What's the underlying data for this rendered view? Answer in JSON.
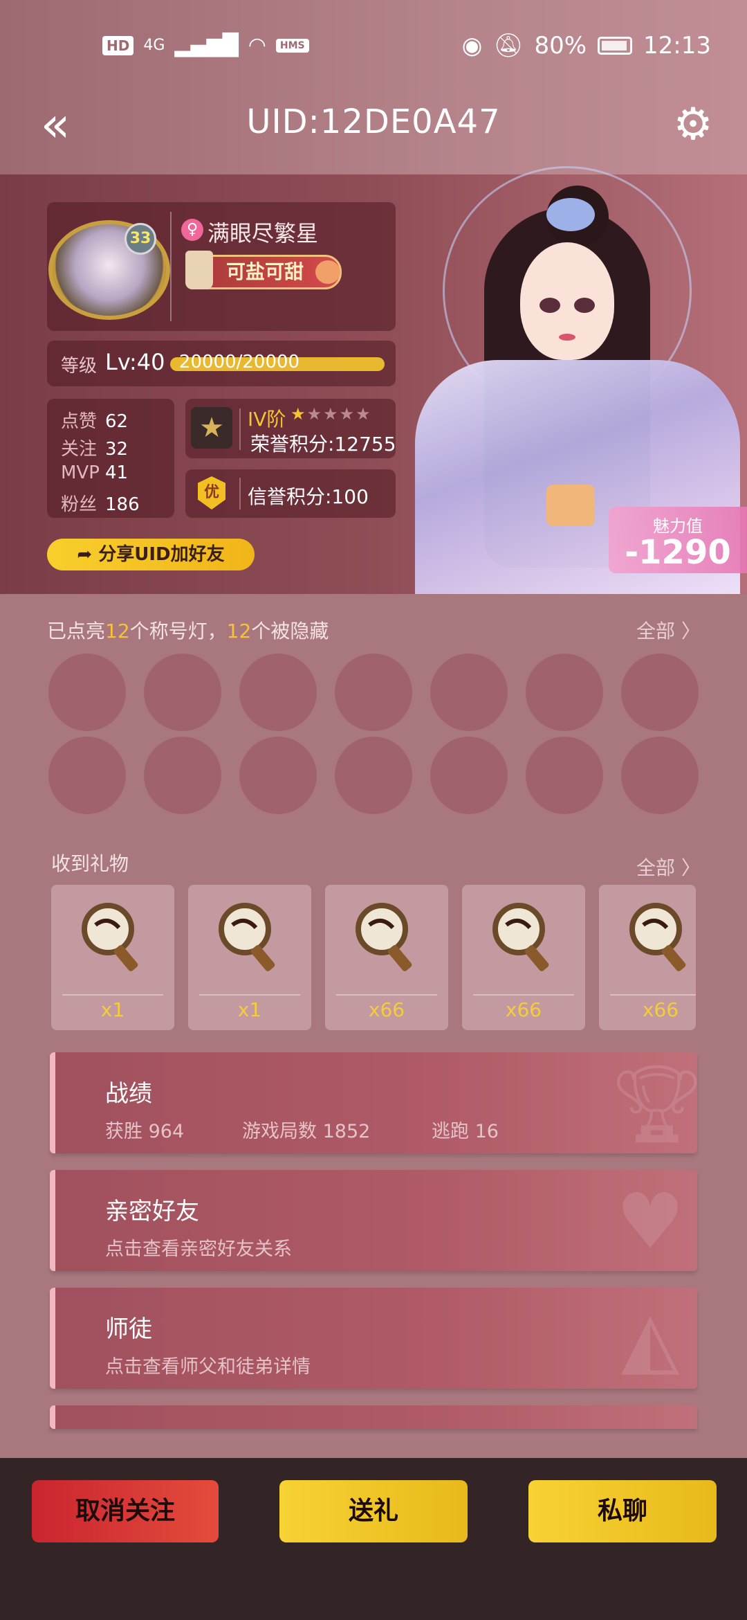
{
  "status_bar": {
    "hd_badge": "HD",
    "network": "4G",
    "hms_badge": "HMS",
    "battery": "80%",
    "time": "12:13"
  },
  "header": {
    "title": "UID:12DE0A47"
  },
  "profile": {
    "level_badge": "33",
    "nickname": "满眼尽繁星",
    "title_badge": "可盐可甜",
    "level_label": "等级",
    "level_value": "Lv:40",
    "xp_text": "20000/20000",
    "xp_progress": 1.0,
    "stats": [
      {
        "label": "点赞",
        "value": "62"
      },
      {
        "label": "关注",
        "value": "32"
      },
      {
        "label": "MVP",
        "value": "41"
      },
      {
        "label": "粉丝",
        "value": "186"
      }
    ],
    "rank_tier": "IV阶",
    "rank_stars_filled": 1,
    "rank_stars_total": 5,
    "honor_points": "荣誉积分:12755",
    "credit_icon": "优",
    "credit_points": "信誉积分:100",
    "share_button": "分享UID加好友",
    "charm_label": "魅力值",
    "charm_value": "-1290"
  },
  "titles_section": {
    "prefix": "已点亮",
    "lit_count": "12",
    "middle": "个称号灯，",
    "hidden_count": "12",
    "suffix": "个被隐藏",
    "all_link": "全部 〉",
    "light_count": 14
  },
  "gifts_section": {
    "title": "收到礼物",
    "all_link": "全部 〉",
    "items": [
      {
        "count": "x1"
      },
      {
        "count": "x1"
      },
      {
        "count": "x66"
      },
      {
        "count": "x66"
      },
      {
        "count": "x66"
      }
    ]
  },
  "menu": {
    "record": {
      "title": "战绩",
      "wins": "获胜 964",
      "games": "游戏局数 1852",
      "escapes": "逃跑 16"
    },
    "friends": {
      "title": "亲密好友",
      "subtitle": "点击查看亲密好友关系"
    },
    "mentor": {
      "title": "师徒",
      "subtitle": "点击查看师父和徒弟详情"
    }
  },
  "bottom_bar": {
    "unfollow": "取消关注",
    "send_gift": "送礼",
    "private_chat": "私聊"
  },
  "colors": {
    "accent_yellow": "#f4c435",
    "header_bg": "#9e6a72",
    "panel_bg": "#7a3d47",
    "menu_row": "#a0515d",
    "unfollow_red": "#c9252f",
    "bottom_bar": "#332526"
  }
}
